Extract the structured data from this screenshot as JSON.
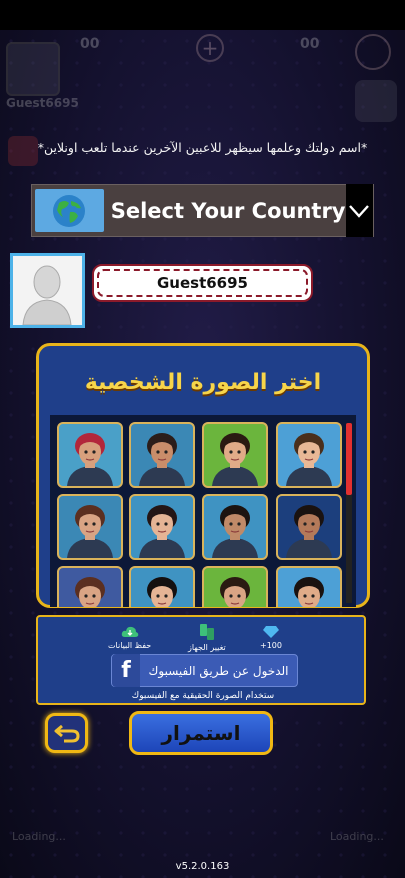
{
  "background_hints": {
    "profile_name": "Guest6695",
    "coins_left": "00",
    "coins_right": "00",
    "plus": "+",
    "loading_left": "Loading...",
    "loading_right": "Loading..."
  },
  "info_text": "*اسم دولتك وعلمها سيظهر للاعبين الآخرين عندما تلعب اونلاين*",
  "country_selector": {
    "label": "Select Your Country",
    "flag_icon": "globe-icon",
    "chevron_icon": "chevron-down-icon"
  },
  "profile": {
    "username": "Guest6695",
    "avatar_icon": "default-avatar-icon"
  },
  "picker": {
    "title": "اختر الصورة الشخصية",
    "portraits": [
      {
        "name": "portrait-1",
        "bg": "#4aa0c8",
        "skin": "#d7a07d",
        "hair": "#b2273b"
      },
      {
        "name": "portrait-2",
        "bg": "#3b88b5",
        "skin": "#c98d6a",
        "hair": "#2b1d1a"
      },
      {
        "name": "portrait-3",
        "bg": "#6bb53d",
        "skin": "#e0ab88",
        "hair": "#2a1a12"
      },
      {
        "name": "portrait-4",
        "bg": "#4da0d6",
        "skin": "#e8b896",
        "hair": "#4a2f1c"
      },
      {
        "name": "portrait-5",
        "bg": "#3b88b5",
        "skin": "#d9a484",
        "hair": "#5b2f20"
      },
      {
        "name": "portrait-6",
        "bg": "#3f93c2",
        "skin": "#e5b495",
        "hair": "#241616"
      },
      {
        "name": "portrait-7",
        "bg": "#3f93c2",
        "skin": "#c08a68",
        "hair": "#1c1410"
      },
      {
        "name": "portrait-8",
        "bg": "#1c3f7d",
        "skin": "#b47a5a",
        "hair": "#1a1210"
      },
      {
        "name": "portrait-9",
        "bg": "#3f5aa0",
        "skin": "#d9a484",
        "hair": "#5b2f20"
      },
      {
        "name": "portrait-10",
        "bg": "#3f93c2",
        "skin": "#e5b495",
        "hair": "#141010"
      },
      {
        "name": "portrait-11",
        "bg": "#6bb53d",
        "skin": "#d9a484",
        "hair": "#2a1a12"
      },
      {
        "name": "portrait-12",
        "bg": "#4da0d6",
        "skin": "#e0ab88",
        "hair": "#1a1210"
      }
    ]
  },
  "facebook_panel": {
    "perks": [
      {
        "label": "حفظ البيانات",
        "icon": "cloud-save-icon"
      },
      {
        "label": "تغيير الجهاز",
        "icon": "change-device-icon"
      },
      {
        "label": "100+",
        "icon": "diamond-icon"
      }
    ],
    "login_label": "الدخول عن طريق الفيسبوك",
    "logo_letter": "f",
    "note": "ستخدام الصورة الحقيقية مع الفيسبوك"
  },
  "buttons": {
    "back_icon": "back-arrow-icon",
    "continue_label": "استمرار"
  },
  "version": "v5.2.0.163",
  "colors": {
    "panel_blue": "#1f3f8a",
    "gold_border": "#e8b41a",
    "title_yellow": "#f7d54a",
    "name_border": "#8b1a2a"
  }
}
